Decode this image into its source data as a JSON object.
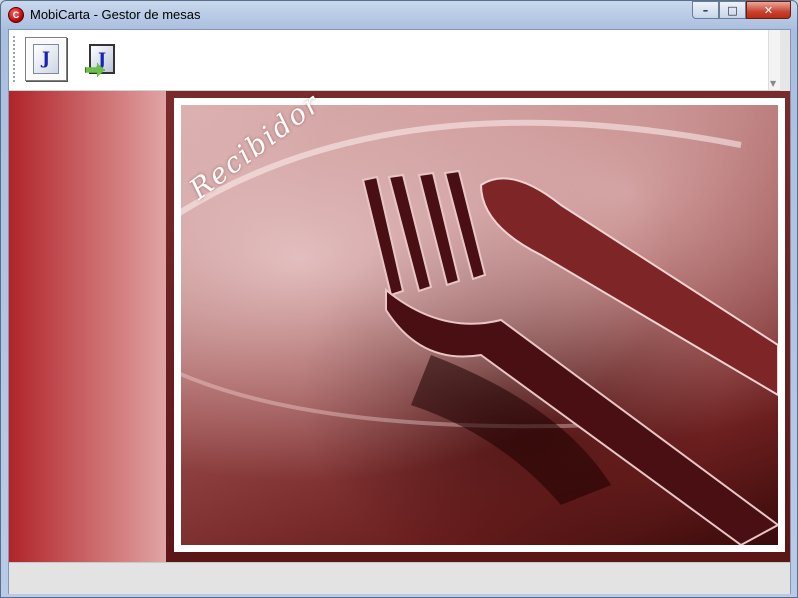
{
  "window": {
    "title": "MobiCarta - Gestor de mesas",
    "app_icon": "mobicarta-logo-icon",
    "controls": {
      "minimize": "–",
      "maximize": "□",
      "close": "✕"
    }
  },
  "toolbar": {
    "buttons": [
      {
        "icon": "document-j-icon",
        "glyph": "J",
        "pressed": true
      },
      {
        "icon": "document-j-send-icon",
        "glyph": "J",
        "pressed": false
      }
    ]
  },
  "main": {
    "banner_text": "Recibidor",
    "accent_color": "#b0242a"
  }
}
